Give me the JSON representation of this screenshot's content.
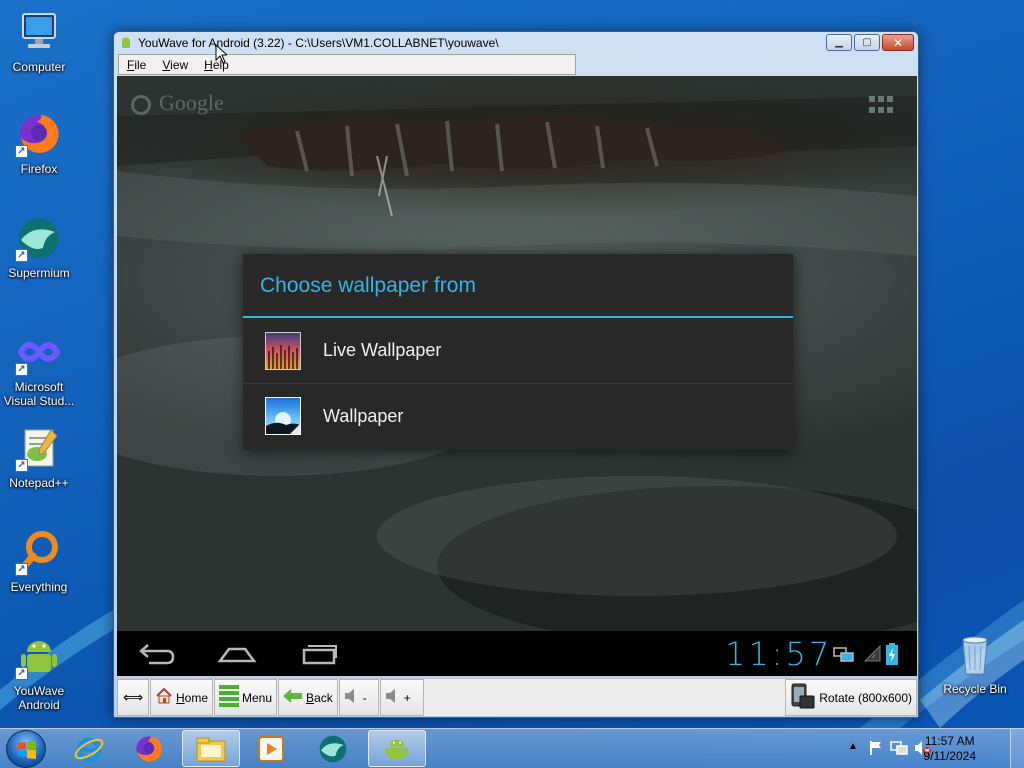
{
  "desktop": {
    "icons": [
      {
        "label": "Computer"
      },
      {
        "label": "Firefox"
      },
      {
        "label": "Supermium"
      },
      {
        "label": "Microsoft Visual Stud..."
      },
      {
        "label": "Notepad++"
      },
      {
        "label": "Everything"
      },
      {
        "label": "YouWave Android"
      },
      {
        "label": "Recycle Bin"
      }
    ]
  },
  "window": {
    "title": "YouWave for Android (3.22) - C:\\Users\\VM1.COLLABNET\\youwave\\",
    "menu": [
      {
        "key": "F",
        "rest": "ile"
      },
      {
        "key": "V",
        "rest": "iew"
      },
      {
        "key": "H",
        "rest": "elp"
      }
    ]
  },
  "android": {
    "search_hint": "Google",
    "dialog": {
      "title": "Choose wallpaper from",
      "options": [
        {
          "label": "Live Wallpaper",
          "icon": "live-wallpaper-icon"
        },
        {
          "label": "Wallpaper",
          "icon": "wallpaper-icon"
        }
      ]
    },
    "clock": "11:57"
  },
  "toolbar": {
    "home": {
      "key": "H",
      "rest": "ome"
    },
    "menu": "Menu",
    "back": {
      "key": "B",
      "rest": "ack"
    },
    "vol_down": "-",
    "vol_up": "+",
    "rotate": "Rotate (800x600)"
  },
  "taskbar": {
    "time": "11:57 AM",
    "date": "9/11/2024"
  },
  "colors": {
    "accent": "#33b5e5",
    "dialog_bg": "#282828",
    "desktop": "#1565c0"
  }
}
